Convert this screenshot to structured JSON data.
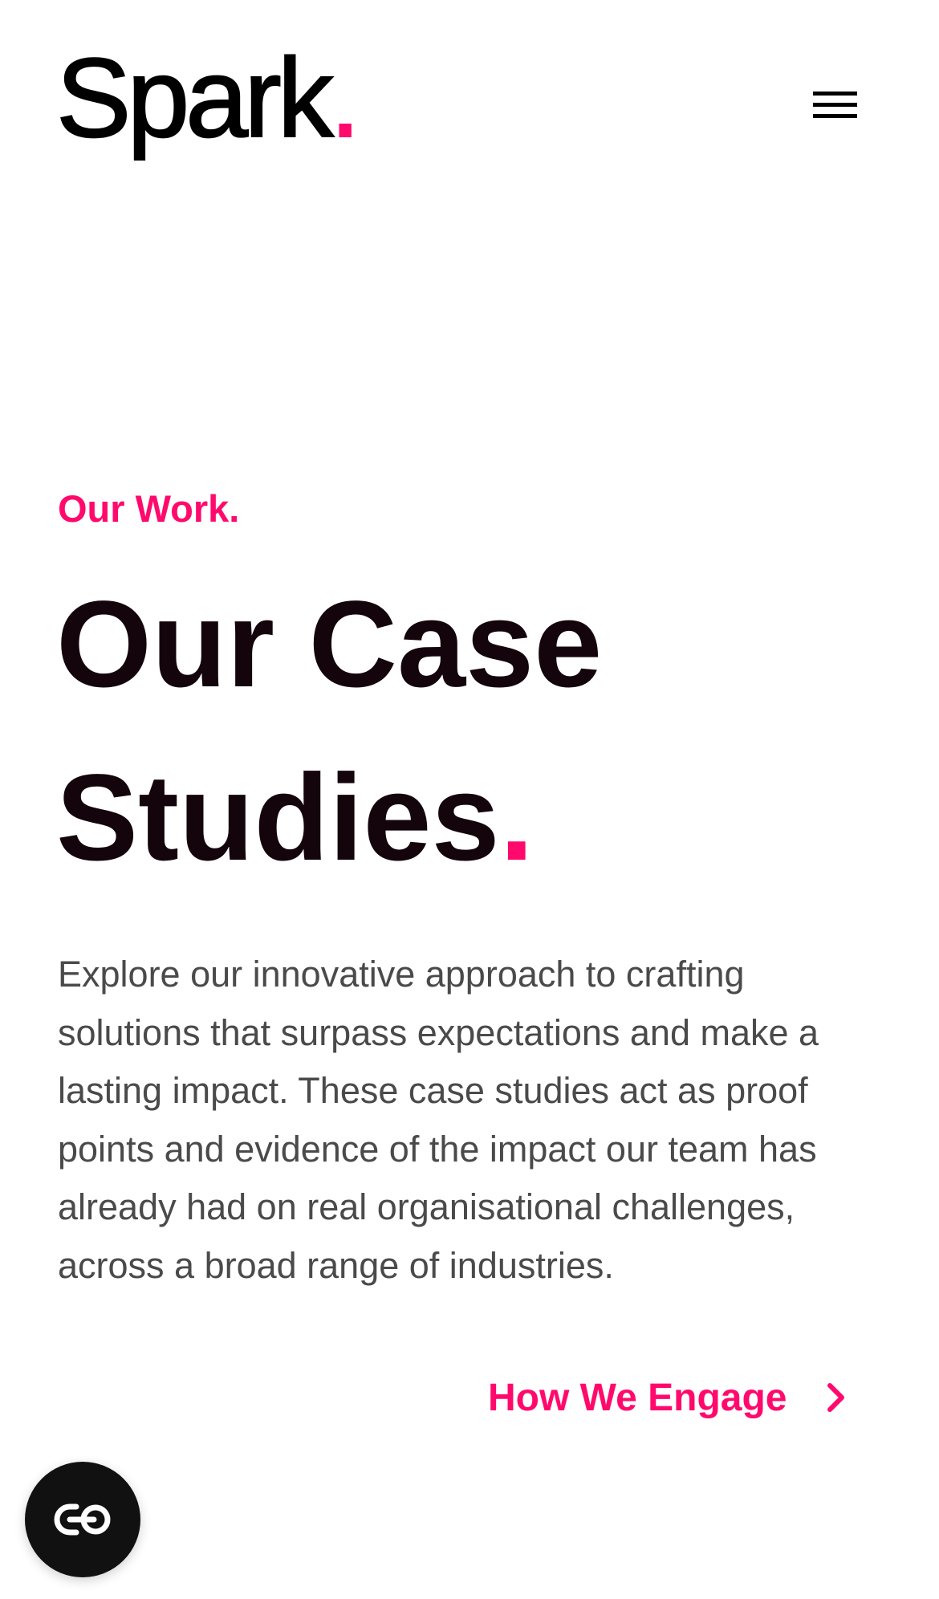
{
  "header": {
    "logo": {
      "text": "Spark",
      "dot": "."
    },
    "menu_icon": "hamburger-menu-icon"
  },
  "hero": {
    "eyebrow": "Our Work.",
    "headline": {
      "line1": "Our Case",
      "line2": "Studies",
      "dot": "."
    },
    "intro": "Explore our innovative approach to crafting solutions that surpass expectations and make a lasting impact. These case studies act as proof points and evidence of the impact our team has already had on real organisational challenges, across a broad range of industries.",
    "cta": {
      "label": "How We Engage",
      "icon": "chevron-right-icon"
    }
  },
  "floating_widget": {
    "icon": "accessibility-toggle-icon"
  },
  "colors": {
    "accent": "#ff0a6c",
    "heading": "#14040b",
    "body_text": "#4a4a4a",
    "widget_bg": "#111111"
  }
}
